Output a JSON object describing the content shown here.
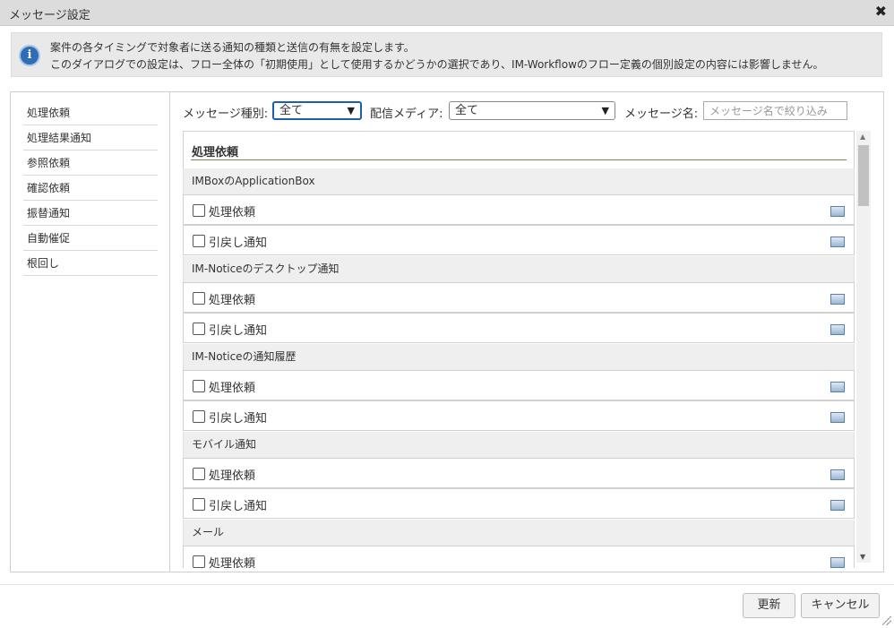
{
  "dialog": {
    "title": "メッセージ設定",
    "close_glyph": "✖"
  },
  "info": {
    "icon": "info-icon",
    "line1": "案件の各タイミングで対象者に送る通知の種類と送信の有無を設定します。",
    "line2": "このダイアログでの設定は、フロー全体の「初期使用」として使用するかどうかの選択であり、IM-Workflowのフロー定義の個別設定の内容には影響しません。"
  },
  "sidebar": {
    "items": [
      {
        "label": "処理依頼"
      },
      {
        "label": "処理結果通知"
      },
      {
        "label": "参照依頼"
      },
      {
        "label": "確認依頼"
      },
      {
        "label": "振替通知"
      },
      {
        "label": "自動催促"
      },
      {
        "label": "根回し"
      }
    ]
  },
  "filters": {
    "type_label": "メッセージ種別:",
    "type_value": "全て",
    "media_label": "配信メディア:",
    "media_value": "全て",
    "name_label": "メッセージ名:",
    "name_placeholder": "メッセージ名で絞り込み",
    "name_value": ""
  },
  "list": {
    "section_title": "処理依頼",
    "groups": [
      {
        "name": "IMBoxのApplicationBox",
        "items": [
          "処理依頼",
          "引戻し通知"
        ]
      },
      {
        "name": "IM-Noticeのデスクトップ通知",
        "items": [
          "処理依頼",
          "引戻し通知"
        ]
      },
      {
        "name": "IM-Noticeの通知履歴",
        "items": [
          "処理依頼",
          "引戻し通知"
        ]
      },
      {
        "name": "モバイル通知",
        "items": [
          "処理依頼",
          "引戻し通知"
        ]
      },
      {
        "name": "メール",
        "items": [
          "処理依頼"
        ]
      }
    ]
  },
  "footer": {
    "update_label": "更新",
    "cancel_label": "キャンセル"
  },
  "colors": {
    "info_icon": "#2f6db5",
    "focus_border": "#1a5fb4",
    "title_underline": "#7a8a4a"
  }
}
